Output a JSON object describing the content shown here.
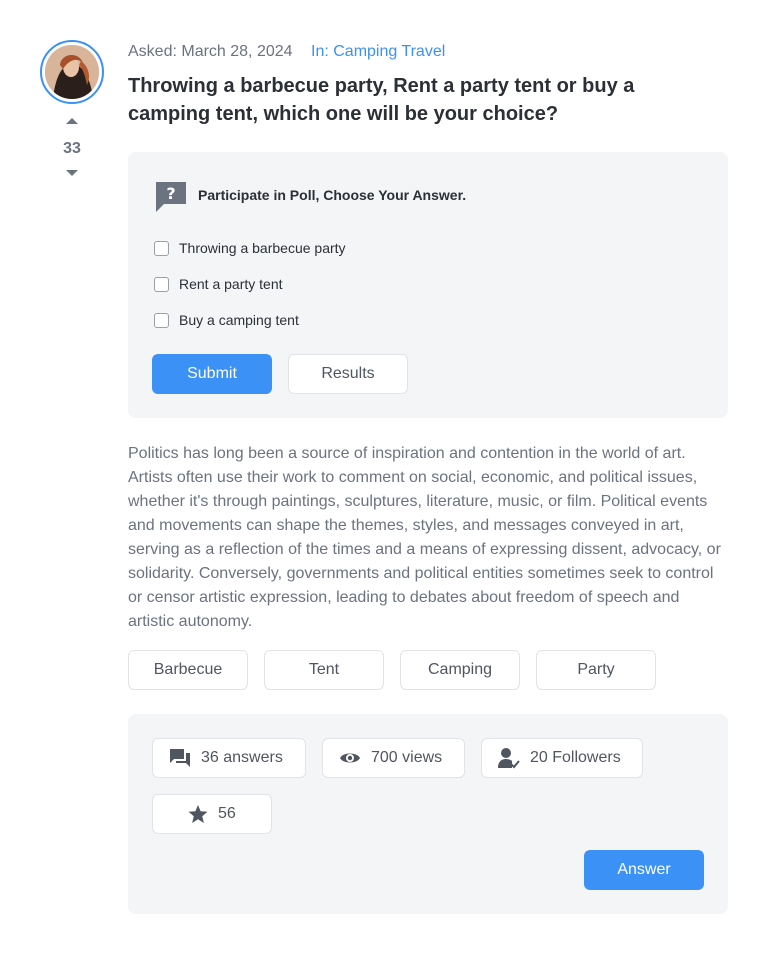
{
  "question": {
    "asked_label": "Asked: March 28, 2024",
    "category_label": "In: Camping Travel",
    "title": "Throwing a barbecue party, Rent a party tent or buy a camping tent, which one will be your choice?",
    "votes": "33"
  },
  "poll": {
    "heading": "Participate in Poll, Choose Your Answer.",
    "options": [
      {
        "label": "Throwing a barbecue party"
      },
      {
        "label": "Rent a party tent"
      },
      {
        "label": "Buy a camping tent"
      }
    ],
    "submit_label": "Submit",
    "results_label": "Results"
  },
  "body": "Politics has long been a source of inspiration and contention in the world of art. Artists often use their work to comment on social, economic, and political issues, whether it's through paintings, sculptures, literature, music, or film. Political events and movements can shape the themes, styles, and messages conveyed in art, serving as a reflection of the times and a means of expressing dissent, advocacy, or solidarity. Conversely, governments and political entities sometimes seek to control or censor artistic expression, leading to debates about freedom of speech and artistic autonomy.",
  "tags": [
    "Barbecue",
    "Tent",
    "Camping",
    "Party"
  ],
  "stats": {
    "answers": "36 answers",
    "views": "700 views",
    "followers": "20 Followers",
    "favorites": "56",
    "answer_button": "Answer"
  },
  "colors": {
    "accent": "#3b91f5",
    "panel_bg": "#f4f5f7",
    "muted_text": "#6b7280"
  }
}
